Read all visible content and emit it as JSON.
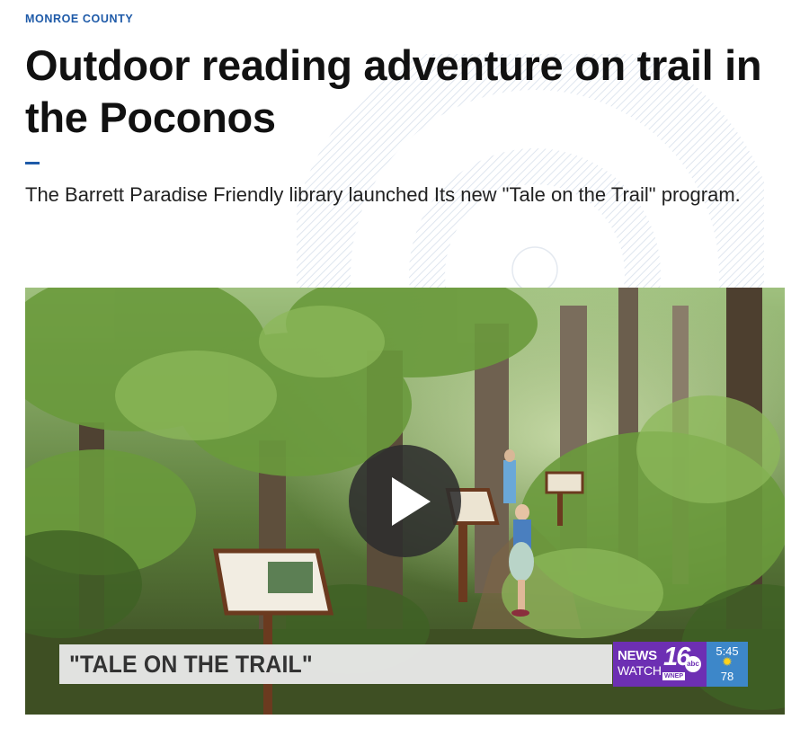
{
  "article": {
    "kicker": "MONROE COUNTY",
    "headline": "Outdoor reading adventure on trail in the Poconos",
    "dek": "The Barrett Paradise Friendly library launched Its new \"Tale on the Trail\" program.",
    "accent_color": "#1e5aa8"
  },
  "video": {
    "play_icon": "play-icon",
    "lower_third": "\"TALE ON THE TRAIL\"",
    "station": {
      "news": "NEWS",
      "watch": "WATCH",
      "number": "16",
      "network": "abc",
      "call_sign": "WNEP",
      "brand_color": "#6d2fb3"
    },
    "weather": {
      "time": "5:45",
      "icon": "sun-icon",
      "temperature": "78"
    }
  }
}
